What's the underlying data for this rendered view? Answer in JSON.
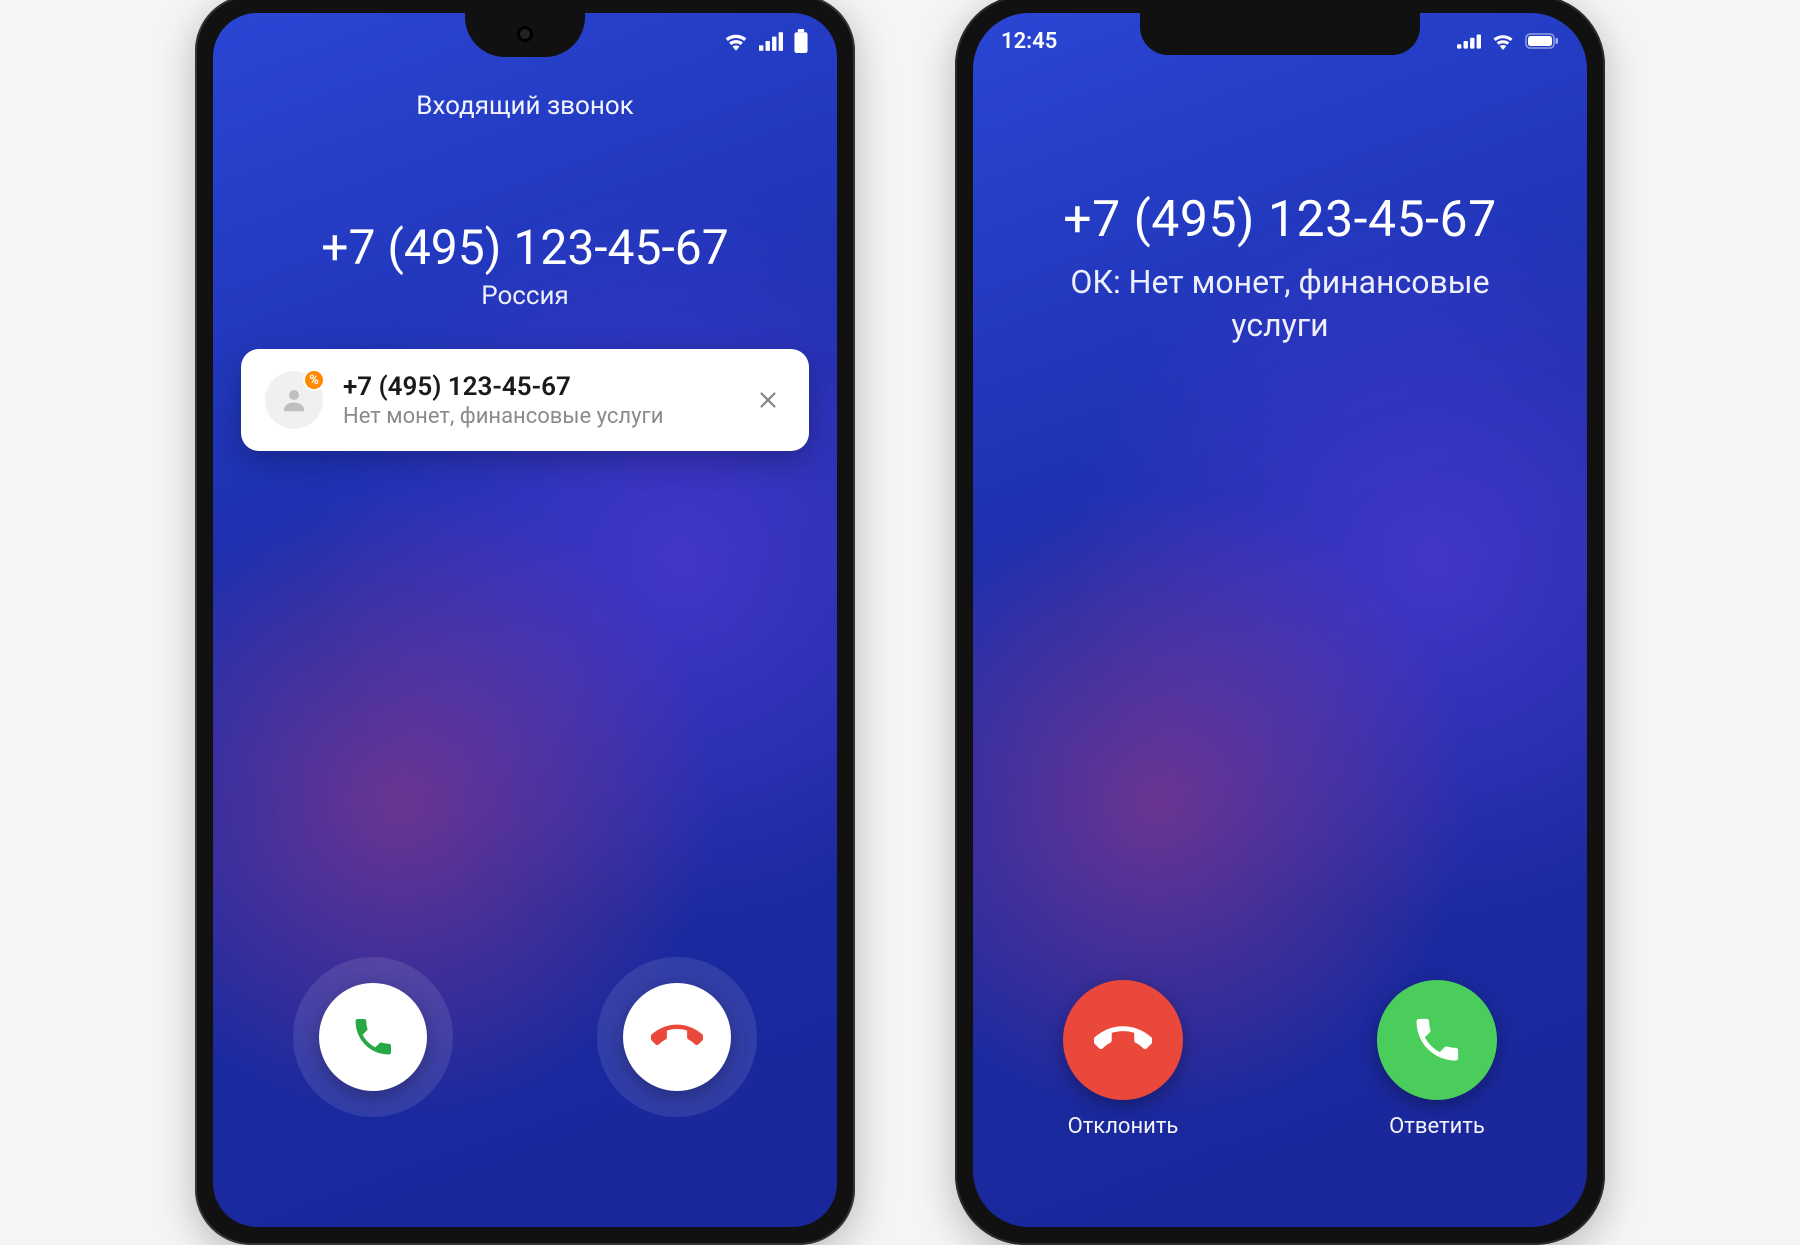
{
  "android": {
    "statusbar": {
      "time": ""
    },
    "incoming_label": "Входящий звонок",
    "number": "+7 (495) 123-45-67",
    "country": "Россия",
    "card": {
      "number": "+7 (495) 123-45-67",
      "subtitle": "Нет монет, финансовые услуги",
      "badge": "%"
    }
  },
  "iphone": {
    "statusbar": {
      "time": "12:45"
    },
    "number": "+7 (495) 123-45-67",
    "subtitle": "ОК: Нет монет, финансовые услуги",
    "decline_label": "Отклонить",
    "accept_label": "Ответить"
  }
}
